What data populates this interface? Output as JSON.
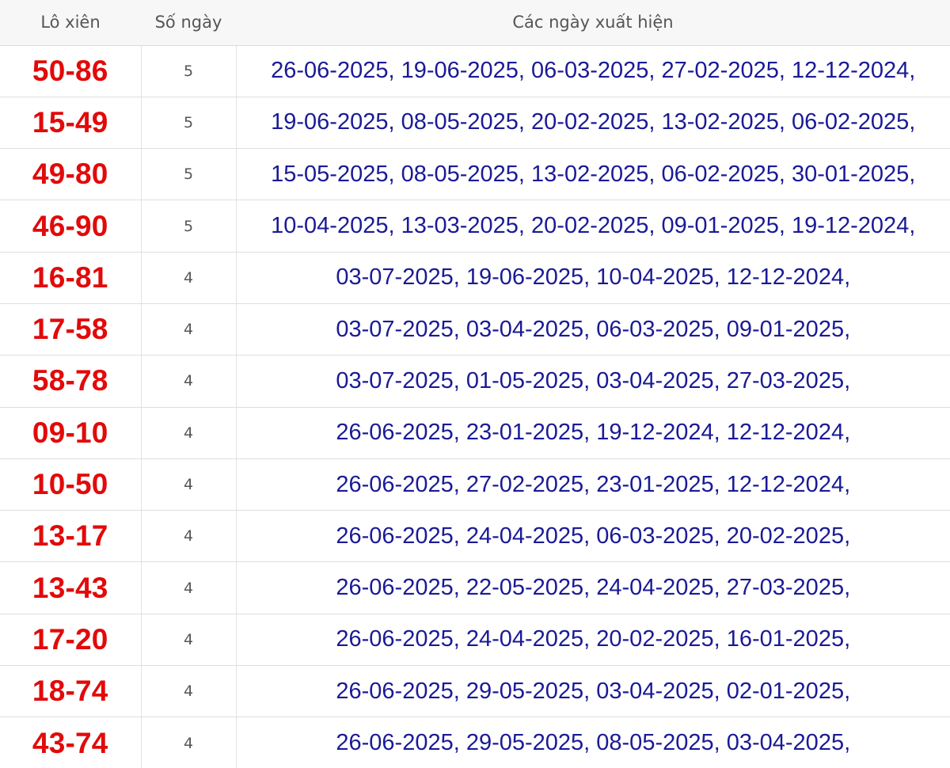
{
  "table": {
    "headers": {
      "pair": "Lô xiên",
      "count": "Số ngày",
      "dates": "Các ngày xuất hiện"
    },
    "rows": [
      {
        "pair": "50-86",
        "count": "5",
        "dates": "26-06-2025, 19-06-2025, 06-03-2025, 27-02-2025, 12-12-2024,"
      },
      {
        "pair": "15-49",
        "count": "5",
        "dates": "19-06-2025, 08-05-2025, 20-02-2025, 13-02-2025, 06-02-2025,"
      },
      {
        "pair": "49-80",
        "count": "5",
        "dates": "15-05-2025, 08-05-2025, 13-02-2025, 06-02-2025, 30-01-2025,"
      },
      {
        "pair": "46-90",
        "count": "5",
        "dates": "10-04-2025, 13-03-2025, 20-02-2025, 09-01-2025, 19-12-2024,"
      },
      {
        "pair": "16-81",
        "count": "4",
        "dates": "03-07-2025, 19-06-2025, 10-04-2025, 12-12-2024,"
      },
      {
        "pair": "17-58",
        "count": "4",
        "dates": "03-07-2025, 03-04-2025, 06-03-2025, 09-01-2025,"
      },
      {
        "pair": "58-78",
        "count": "4",
        "dates": "03-07-2025, 01-05-2025, 03-04-2025, 27-03-2025,"
      },
      {
        "pair": "09-10",
        "count": "4",
        "dates": "26-06-2025, 23-01-2025, 19-12-2024, 12-12-2024,"
      },
      {
        "pair": "10-50",
        "count": "4",
        "dates": "26-06-2025, 27-02-2025, 23-01-2025, 12-12-2024,"
      },
      {
        "pair": "13-17",
        "count": "4",
        "dates": "26-06-2025, 24-04-2025, 06-03-2025, 20-02-2025,"
      },
      {
        "pair": "13-43",
        "count": "4",
        "dates": "26-06-2025, 22-05-2025, 24-04-2025, 27-03-2025,"
      },
      {
        "pair": "17-20",
        "count": "4",
        "dates": "26-06-2025, 24-04-2025, 20-02-2025, 16-01-2025,"
      },
      {
        "pair": "18-74",
        "count": "4",
        "dates": "26-06-2025, 29-05-2025, 03-04-2025, 02-01-2025,"
      },
      {
        "pair": "43-74",
        "count": "4",
        "dates": "26-06-2025, 29-05-2025, 08-05-2025, 03-04-2025,"
      }
    ]
  }
}
